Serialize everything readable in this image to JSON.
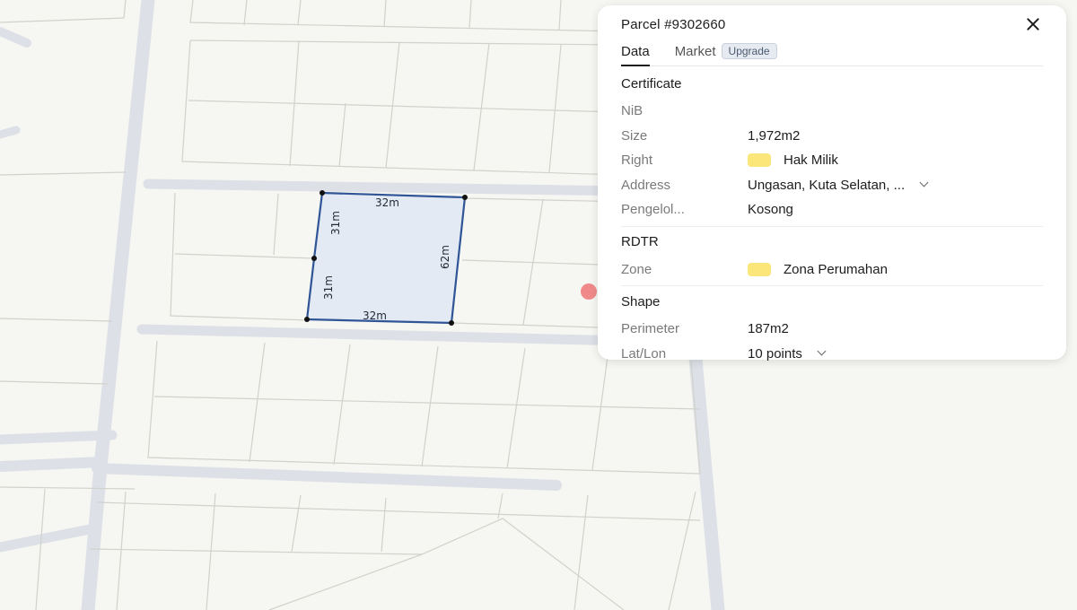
{
  "parcel": {
    "title": "Parcel #9302660",
    "tabs": [
      {
        "label": "Data",
        "active": true
      },
      {
        "label": "Market",
        "badge": "Upgrade"
      }
    ],
    "sections": {
      "certificate": {
        "title": "Certificate",
        "rows": [
          {
            "label": "NiB",
            "value": ""
          },
          {
            "label": "Size",
            "value": "1,972m2"
          },
          {
            "label": "Right",
            "value": "Hak Milik",
            "swatch": "#fbe67a"
          },
          {
            "label": "Address",
            "value": "Ungasan, Kuta Selatan, ...",
            "expandable": true
          },
          {
            "label": "Pengelol...",
            "value": "Kosong"
          }
        ]
      },
      "rdtr": {
        "title": "RDTR",
        "rows": [
          {
            "label": "Zone",
            "value": "Zona Perumahan",
            "swatch": "#fbe67a"
          }
        ]
      },
      "shape": {
        "title": "Shape",
        "rows": [
          {
            "label": "Perimeter",
            "value": "187m2"
          },
          {
            "label": "Lat/Lon",
            "value": "10 points",
            "expandable": true
          }
        ]
      }
    }
  },
  "map": {
    "selected_parcel": {
      "edge_labels": [
        "32m",
        "62m",
        "32m",
        "31m",
        "31m"
      ],
      "fill": "#e3eaf4",
      "stroke": "#2f5597"
    },
    "colors": {
      "background": "#f6f6f2",
      "road": "#dde0e6",
      "lot_line": "#d2d2cc",
      "marker": "#f08a8a"
    }
  }
}
